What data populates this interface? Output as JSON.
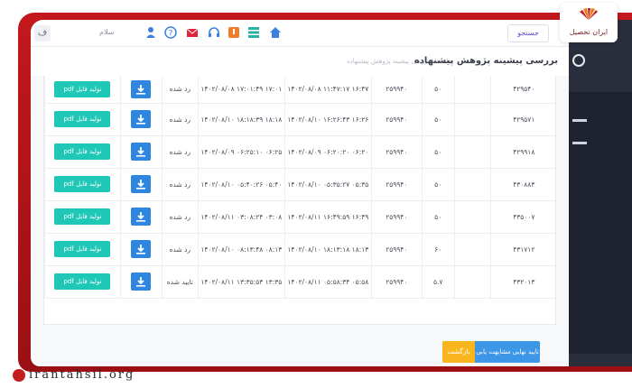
{
  "topbar": {
    "f_badge": "ف",
    "greeting": "سلام",
    "search_label": "جستجو"
  },
  "page": {
    "title": "بررسی پیشینه پژوهش پیشنهاده",
    "breadcrumb": "خانه ‹ ‹ بررسی پیشینه پژوهش پیشنهاده"
  },
  "logo": {
    "text": "ایران تحصیل"
  },
  "rows": [
    {
      "id": "۴۲۹۵۴۰",
      "num2": "۲۵۹۹۴۰",
      "num1": "۵۰",
      "date2": "۱۴۰۲/۰۸/۰۸ ۱۱:۴۷:۱۷ ۱۶:۴۷",
      "date1": "۱۴۰۲/۰۸/۰۸ ۱۷:۰۱:۴۹ ۱۷:۰۱",
      "status": "رد شده",
      "pdf": "تولید فایل pdf"
    },
    {
      "id": "۴۲۹۵۷۱",
      "num2": "۲۵۹۹۴۰",
      "num1": "۵۰",
      "date2": "۱۴۰۲/۰۸/۱۰ ۱۶:۲۶:۴۳ ۱۶:۲۶",
      "date1": "۱۴۰۲/۰۸/۱۰ ۱۸:۱۸:۳۹ ۱۸:۱۸",
      "status": "رد شده",
      "pdf": "تولید فایل pdf"
    },
    {
      "id": "۴۲۹۹۱۸",
      "num2": "۲۵۹۹۴۰",
      "num1": "۵۰",
      "date2": "۱۴۰۲/۰۸/۰۹ ۰۶:۲۰:۲۰ ۰۶:۲۰",
      "date1": "۱۴۰۲/۰۸/۰۹ ۰۶:۲۵:۱۰ ۰۶:۲۵",
      "status": "رد شده",
      "pdf": "تولید فایل pdf"
    },
    {
      "id": "۴۳۰۸۸۳",
      "num2": "۲۵۹۹۴۰",
      "num1": "۵۰",
      "date2": "۱۴۰۲/۰۸/۱۰ ۰۵:۳۵:۲۷ ۰۵:۳۵",
      "date1": "۱۴۰۲/۰۸/۱۰ ۰۵:۴۰:۲۶ ۰۵:۴۰",
      "status": "رد شده",
      "pdf": "تولید فایل pdf"
    },
    {
      "id": "۴۳۵۰۰۷",
      "num2": "۲۵۹۹۴۰",
      "num1": "۵۰",
      "date2": "۱۴۰۲/۰۸/۱۱ ۱۶:۴۹:۵۹ ۱۶:۴۹",
      "date1": "۱۴۰۲/۰۸/۱۱ ۰۳:۰۸:۲۴ ۰۳:۰۸",
      "status": "رد شده",
      "pdf": "تولید فایل pdf"
    },
    {
      "id": "۴۳۱۷۱۲",
      "num2": "۲۵۹۹۴۰",
      "num1": "۶۰",
      "date2": "۱۴۰۲/۰۸/۱۰ ۱۸:۱۳:۱۸ ۱۸:۱۳",
      "date1": "۱۴۰۲/۰۸/۱۰ ۰۸:۱۳:۴۸ ۰۸:۱۳",
      "status": "رد شده",
      "pdf": "تولید فایل pdf"
    },
    {
      "id": "۴۳۲۰۱۳",
      "num2": "۲۵۹۹۴۰",
      "num1": "۵.۷",
      "date2": "۱۴۰۲/۰۸/۱۱ ۰۵:۵۸:۳۴ ۰۵:۵۸",
      "date1": "۱۴۰۲/۰۸/۱۱ ۱۳:۳۵:۵۳ ۱۳:۳۵",
      "status": "تایید شده",
      "pdf": "تولید فایل pdf"
    }
  ],
  "footer": {
    "return_label": "بازگشت",
    "final_label": "تایید نهایی مشابهت یابی"
  },
  "watermark": "irantahsil.org",
  "colors": {
    "pdf_button": "#1fc7b6",
    "download_button": "#2f86e0",
    "return_button": "#f8b51e",
    "final_button": "#3d96e6",
    "frame_ribbon": "#c2181d",
    "sidebar": "#2a2d3b"
  }
}
